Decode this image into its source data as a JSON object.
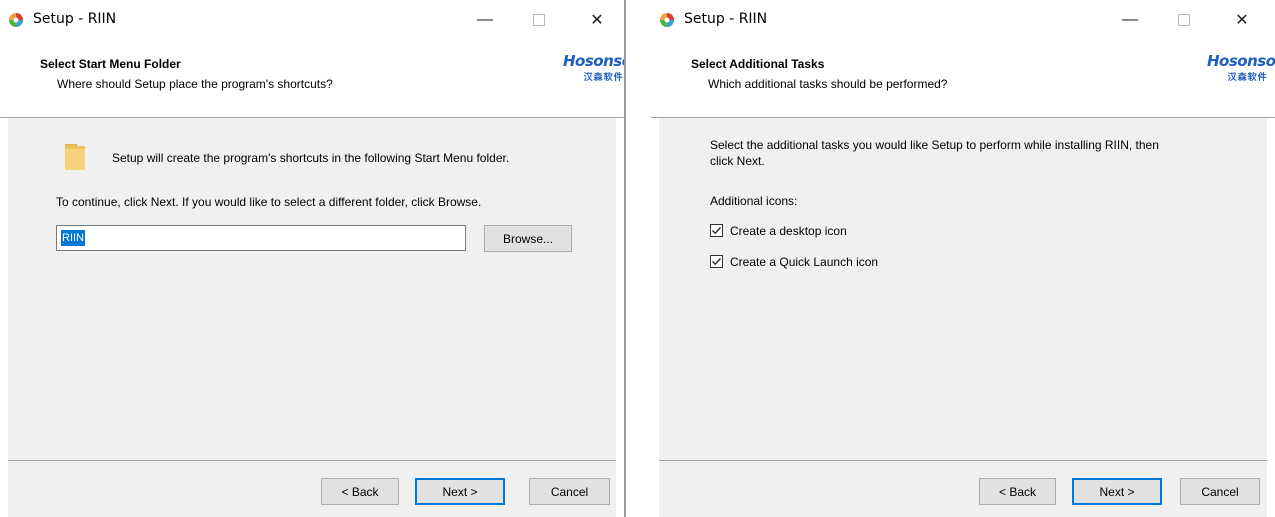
{
  "left_window": {
    "title": "Setup - RIIN",
    "header": {
      "title": "Select Start Menu Folder",
      "subtitle": "Where should Setup place the program's shortcuts?"
    },
    "logo": {
      "brand": "Hosonsoft",
      "chinese": "汉森软件"
    },
    "body": {
      "info_text": "Setup will create the program's shortcuts in the following Start Menu folder.",
      "instruction": "To continue, click Next. If you would like to select a different folder, click Browse.",
      "folder_value": "RIIN",
      "browse_label": "Browse..."
    },
    "buttons": {
      "back": "< Back",
      "next": "Next >",
      "cancel": "Cancel"
    }
  },
  "right_window": {
    "title": "Setup - RIIN",
    "header": {
      "title": "Select Additional Tasks",
      "subtitle": "Which additional tasks should be performed?"
    },
    "logo": {
      "brand": "Hosonsoft",
      "chinese": "汉森软件"
    },
    "body": {
      "intro_line1": "Select the additional tasks you would like Setup to perform while installing RIIN, then",
      "intro_line2": "click Next.",
      "group_label": "Additional icons:",
      "tasks": [
        {
          "label": "Create a desktop icon",
          "checked": true
        },
        {
          "label": "Create a Quick Launch icon",
          "checked": true
        }
      ]
    },
    "buttons": {
      "back": "< Back",
      "next": "Next >",
      "cancel": "Cancel"
    }
  },
  "colors": {
    "accent": "#0078d7",
    "panel_bg": "#f0f0f0",
    "logo_blue": "#1f5fbf"
  }
}
